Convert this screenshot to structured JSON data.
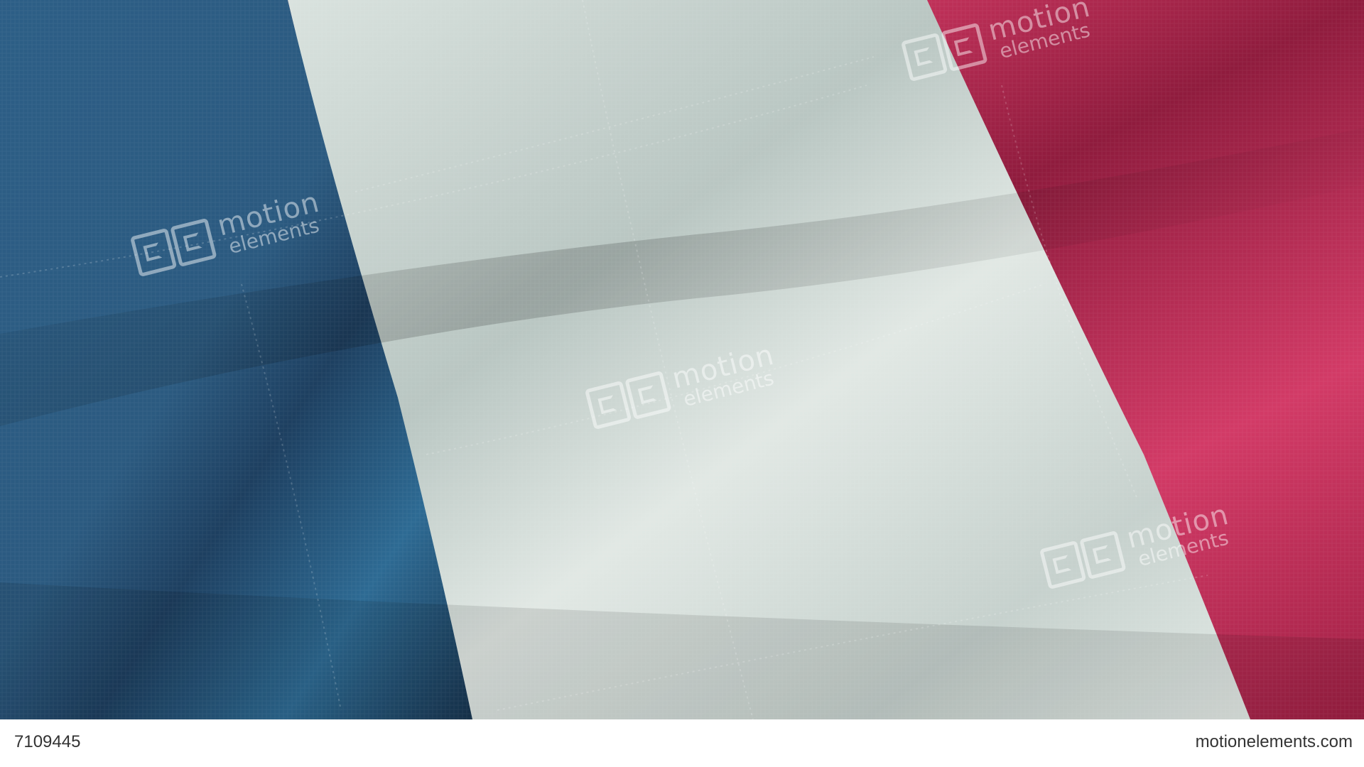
{
  "flag": {
    "colors": {
      "blue": "#2f6690",
      "white": "#d6e0dc",
      "red": "#cc2f5b"
    }
  },
  "watermarks": [
    {
      "line1": "motion",
      "line2": "elements"
    },
    {
      "line1": "motion",
      "line2": "elements"
    },
    {
      "line1": "motion",
      "line2": "elements"
    },
    {
      "line1": "motion",
      "line2": "elements"
    }
  ],
  "caption": {
    "stock_id": "7109445",
    "site": "motionelements.com"
  }
}
